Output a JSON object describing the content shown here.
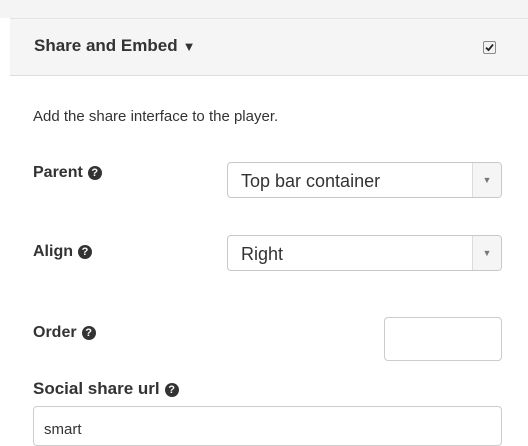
{
  "panel": {
    "title": "Share and Embed",
    "caret": "▼",
    "enabled": true
  },
  "description": "Add the share interface to the player.",
  "fields": {
    "parent": {
      "label": "Parent",
      "value": "Top bar container"
    },
    "align": {
      "label": "Align",
      "value": "Right"
    },
    "order": {
      "label": "Order",
      "value": ""
    },
    "social_share_url": {
      "label": "Social share url",
      "value": "smart"
    }
  },
  "icons": {
    "help": "question-circle-icon",
    "dropdown": "chevron-down-icon",
    "checkmark": "checkmark-icon"
  }
}
